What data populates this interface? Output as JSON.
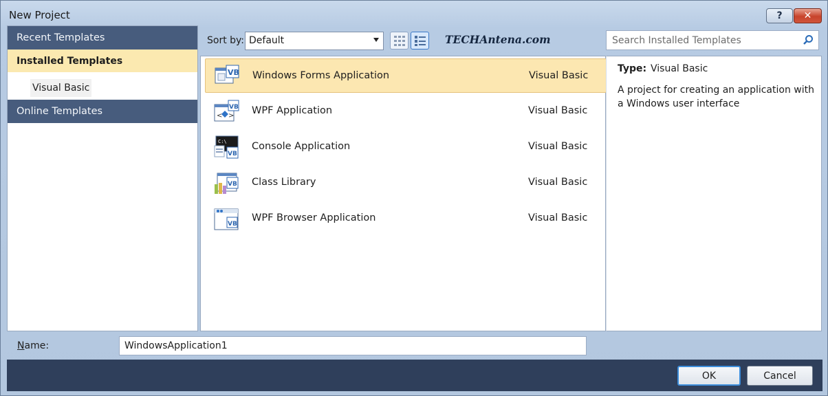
{
  "window": {
    "title": "New Project",
    "help_label": "?",
    "close_label": "✕"
  },
  "sidebar": {
    "recent": "Recent Templates",
    "installed": "Installed Templates",
    "installed_child": "Visual Basic",
    "online": "Online Templates"
  },
  "toolbar": {
    "sort_label": "Sort by:",
    "sort_value": "Default",
    "watermark": "TECHAntena.com"
  },
  "search": {
    "placeholder": "Search Installed Templates"
  },
  "templates": [
    {
      "name": "Windows Forms Application",
      "language": "Visual Basic",
      "icon": "windows-forms-vb-icon",
      "selected": true
    },
    {
      "name": "WPF Application",
      "language": "Visual Basic",
      "icon": "wpf-vb-icon",
      "selected": false
    },
    {
      "name": "Console Application",
      "language": "Visual Basic",
      "icon": "console-vb-icon",
      "selected": false
    },
    {
      "name": "Class Library",
      "language": "Visual Basic",
      "icon": "class-library-vb-icon",
      "selected": false
    },
    {
      "name": "WPF Browser Application",
      "language": "Visual Basic",
      "icon": "wpf-browser-vb-icon",
      "selected": false
    }
  ],
  "details": {
    "type_label": "Type:",
    "type_value": "Visual Basic",
    "description": "A project for creating an application with a Windows user interface"
  },
  "name_field": {
    "label_accel": "N",
    "label_rest": "ame:",
    "value": "WindowsApplication1"
  },
  "buttons": {
    "ok": "OK",
    "cancel": "Cancel"
  },
  "colors": {
    "accent": "#475c7d",
    "selection": "#fce7b1",
    "footer": "#2f3f5b"
  }
}
